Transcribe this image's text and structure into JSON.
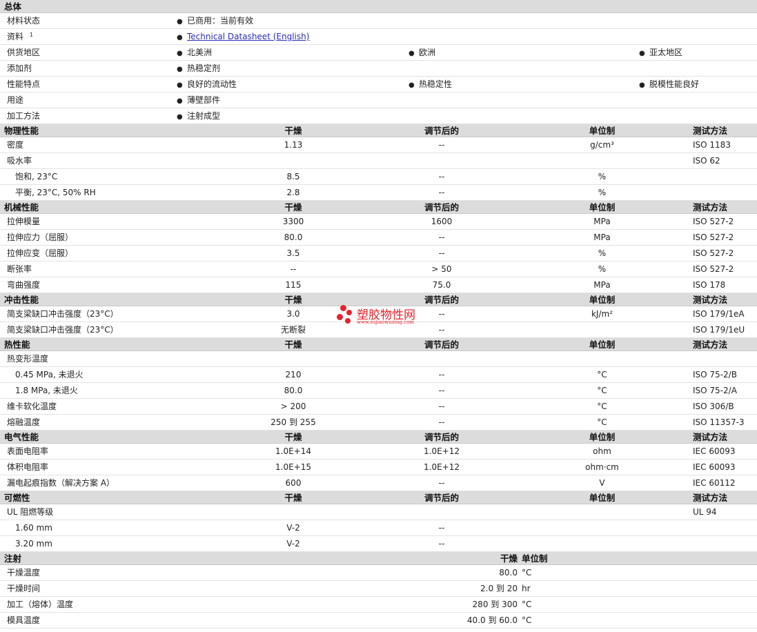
{
  "general": {
    "header": "总体",
    "rows": [
      {
        "label": "材料状态",
        "items": [
          "已商用：当前有效"
        ]
      },
      {
        "label": "资料",
        "sup": "1",
        "items": [
          "Technical Datasheet (English)"
        ],
        "link": true
      },
      {
        "label": "供货地区",
        "items": [
          "北美洲",
          "欧洲",
          "亚太地区"
        ]
      },
      {
        "label": "添加剂",
        "items": [
          "热稳定剂"
        ]
      },
      {
        "label": "性能特点",
        "items": [
          "良好的流动性",
          "热稳定性",
          "脱模性能良好"
        ]
      },
      {
        "label": "用途",
        "items": [
          "薄壁部件"
        ]
      },
      {
        "label": "加工方法",
        "items": [
          "注射成型"
        ]
      }
    ]
  },
  "columns": {
    "dry": "干燥",
    "conditioned": "调节后的",
    "unit": "单位制",
    "test": "测试方法"
  },
  "sections": [
    {
      "title": "物理性能",
      "rows": [
        {
          "label": "密度",
          "dry": "1.13",
          "cond": "--",
          "unit": "g/cm³",
          "test": "ISO 1183"
        },
        {
          "label": "吸水率",
          "dry": "",
          "cond": "",
          "unit": "",
          "test": "ISO 62"
        },
        {
          "label": "饱和, 23°C",
          "indent": true,
          "dry": "8.5",
          "cond": "--",
          "unit": "%",
          "test": ""
        },
        {
          "label": "平衡, 23°C, 50% RH",
          "indent": true,
          "dry": "2.8",
          "cond": "--",
          "unit": "%",
          "test": ""
        }
      ]
    },
    {
      "title": "机械性能",
      "rows": [
        {
          "label": "拉伸模量",
          "dry": "3300",
          "cond": "1600",
          "unit": "MPa",
          "test": "ISO 527-2"
        },
        {
          "label": "拉伸应力（屈服）",
          "dry": "80.0",
          "cond": "--",
          "unit": "MPa",
          "test": "ISO 527-2"
        },
        {
          "label": "拉伸应变（屈服）",
          "dry": "3.5",
          "cond": "--",
          "unit": "%",
          "test": "ISO 527-2"
        },
        {
          "label": "断张率",
          "dry": "--",
          "cond": "> 50",
          "unit": "%",
          "test": "ISO 527-2"
        },
        {
          "label": "弯曲强度",
          "dry": "115",
          "cond": "75.0",
          "unit": "MPa",
          "test": "ISO 178"
        }
      ]
    },
    {
      "title": "冲击性能",
      "rows": [
        {
          "label": "简支梁缺口冲击强度（23°C）",
          "dry": "3.0",
          "cond": "--",
          "unit": "kJ/m²",
          "test": "ISO 179/1eA"
        },
        {
          "label": "简支梁缺口冲击强度（23°C）",
          "dry": "无断裂",
          "cond": "--",
          "unit": "",
          "test": "ISO 179/1eU"
        }
      ]
    },
    {
      "title": "热性能",
      "rows": [
        {
          "label": "热变形温度",
          "dry": "",
          "cond": "",
          "unit": "",
          "test": ""
        },
        {
          "label": "0.45 MPa, 未退火",
          "indent": true,
          "dry": "210",
          "cond": "--",
          "unit": "°C",
          "test": "ISO 75-2/B"
        },
        {
          "label": "1.8 MPa, 未退火",
          "indent": true,
          "dry": "80.0",
          "cond": "--",
          "unit": "°C",
          "test": "ISO 75-2/A"
        },
        {
          "label": "维卡软化温度",
          "dry": "> 200",
          "cond": "--",
          "unit": "°C",
          "test": "ISO 306/B"
        },
        {
          "label": "熔融温度",
          "dry": "250 到  255",
          "cond": "--",
          "unit": "°C",
          "test": "ISO 11357-3"
        }
      ]
    },
    {
      "title": "电气性能",
      "rows": [
        {
          "label": "表面电阻率",
          "dry": "1.0E+14",
          "cond": "1.0E+12",
          "unit": "ohm",
          "test": "IEC 60093"
        },
        {
          "label": "体积电阻率",
          "dry": "1.0E+15",
          "cond": "1.0E+12",
          "unit": "ohm·cm",
          "test": "IEC 60093"
        },
        {
          "label": "漏电起痕指数（解决方案  A）",
          "dry": "600",
          "cond": "--",
          "unit": "V",
          "test": "IEC 60112"
        }
      ]
    },
    {
      "title": "可燃性",
      "rows": [
        {
          "label": "UL 阻燃等级",
          "dry": "",
          "cond": "",
          "unit": "",
          "test": "UL 94"
        },
        {
          "label": "1.60 mm",
          "indent": true,
          "dry": "V-2",
          "cond": "--",
          "unit": "",
          "test": ""
        },
        {
          "label": "3.20 mm",
          "indent": true,
          "dry": "V-2",
          "cond": "--",
          "unit": "",
          "test": ""
        }
      ]
    }
  ],
  "injection": {
    "title": "注射",
    "dry_header": "干燥",
    "unit_header": "单位制",
    "rows": [
      {
        "label": "干燥温度",
        "value": "80.0",
        "unit": "°C"
      },
      {
        "label": "干燥时间",
        "value": "2.0 到  20",
        "unit": "hr"
      },
      {
        "label": "加工（熔体）温度",
        "value": "280 到  300",
        "unit": "°C"
      },
      {
        "label": "模具温度",
        "value": "40.0 到  60.0",
        "unit": "°C"
      }
    ]
  },
  "watermark": {
    "text": "塑胶物性网",
    "url": "www.sujiaowuxing.com",
    "color": "#e8212a"
  }
}
